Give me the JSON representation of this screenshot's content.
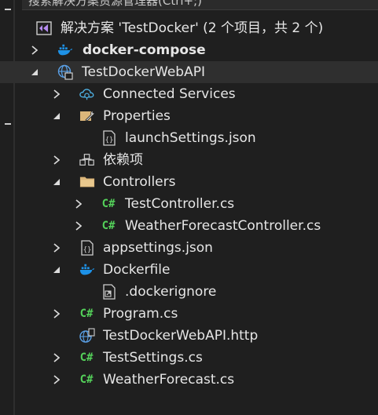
{
  "search": {
    "placeholder": "搜索解决方案资源管理器(Ctrl+;)"
  },
  "solution": {
    "label": "解决方案 'TestDocker' (2 个项目，共 2 个)"
  },
  "nodes": {
    "docker_compose": "docker-compose",
    "project": "TestDockerWebAPI",
    "connected_services": "Connected Services",
    "properties": "Properties",
    "launch_settings": "launchSettings.json",
    "dependencies": "依赖项",
    "controllers": "Controllers",
    "test_controller": "TestController.cs",
    "weather_controller": "WeatherForecastController.cs",
    "appsettings": "appsettings.json",
    "dockerfile": "Dockerfile",
    "dockerignore": ".dockerignore",
    "program": "Program.cs",
    "http_file": "TestDockerWebAPI.http",
    "test_settings": "TestSettings.cs",
    "weather_forecast": "WeatherForecast.cs"
  },
  "icons": {
    "cs_glyph": "C#"
  },
  "colors": {
    "background": "#1f1f1f",
    "text": "#e6e6e6",
    "csharp": "#54d15a",
    "docker": "#1d91e6",
    "folder": "#dcb67a"
  }
}
